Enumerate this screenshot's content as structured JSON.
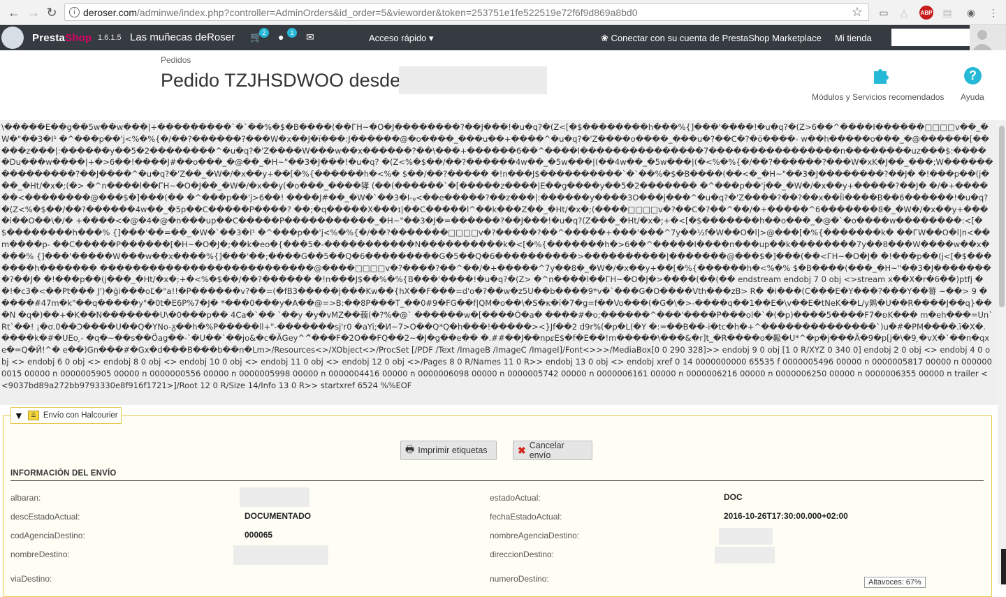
{
  "browser": {
    "url_domain": "deroser.com",
    "url_path": "/adminwe/index.php?controller=AdminOrders&id_order=5&vieworder&token=253751e1fe522519e72f6f9d869a8bd0",
    "abp_label": "ABP"
  },
  "header": {
    "logo_presta": "Presta",
    "logo_shop": "Shop",
    "version": "1.6.1.5",
    "shop_name": "Las muñecas deRoser",
    "orders_badge": "2",
    "customers_badge": "1",
    "quick_access": "Acceso rápido",
    "marketplace": "Conectar con su cuenta de PrestaShop Marketplace",
    "my_store": "Mi tienda"
  },
  "page": {
    "breadcrumb": "Pedidos",
    "title": "Pedido TZJHSDWOO desde",
    "modules_label": "Módulos y Servicios recomendados",
    "help_label": "Ayuda"
  },
  "dump": {
    "text": "\\�����E��g��5w��w���|+���������`�`��%�$�B����(��ГH~�O�J��������?��J���!�u�q?�(Z<[�$��������h���%{]���'����!�u�q?�(Z>6��^����I������□□□□v��_�W�\"��3�I¹ �^���p��'j<%�%{�/��?������?���W�x��J�ï���:J������@�o����_���u��+����^�u�q?�'Z����o����_���u�?��C�?�ö����- w��h�����o���_�@������[�����z���|:������y��5�2��������^�u�q?�'Z����W���w��x������?��\\���+������6��^����I���������������7����������������n��������uz���$:�����Du���w����|+�>6��!����J#��o���_�@��_�H~\"��3�J���!�u�q? �(Z<%�$��/��?������4w��_�5w���|(��4w��_�5w���|(�<%�%{�/��?������?���W�xK�J��_���;W���������������?��J����^�u�q?�'Z��_�W�/�x��y+��[�%{������h�<%� $��/��?����� �!n���J$����������`�`��%�$�B����(��<�_�H~\"��3�J��������?��J� �!���p��(j���_�Ht/�x�:̣(�> �^n����l��ГH~�O�J��_�W�/�x��y(�o���_����㹲 (��(������`�[�����z����|E��g����y��5�2������� �^���p��'j��_�W�/�x��y+�����?��J� �/�+������<��������@���$�]���(�� �^���p��'j>6��! ����J#��_�W�`��3�I-ᵩ<��e�����?��z���|:������y����3O���j���^�u�q?�'Z����?��?��x��Ïi����B��6������!�u�q?�(Z<%�$��/��?������4w��_�5p��C�����P����? ��;�q�����X���ɪ|��C�����l^��k���Z��_�Ht/�x�:̣(����□□□□v�?��C�?��^��/�+�����^6�������8�_�W�/�x��y+����i��O��\\�/� +����<�@�4�@�n���up��C�����P�����������_�H~\"��3�J�=������?��J���!�u�q?(Z���_�Ht/�x�:̣+�<[�$�������h��o���_�@�`�o����w��������:<[�$��������h���% {]���'��=��_�W�`��3�I¹ �^���p��'j<%�%{�/��?�������□□□□v�?�����?��^�����+���'���^7y��½f�W��O�l|>@���[�%{�������k� ��ГW��O�l|n<��m����p- ��C�����P������[�H~�O�J�;��k�eo�{���5�-�����������N����������k�<[�%{�������h�>6��^�����I����n���up��k��������7y��8���W����w��x����% {]���'�����W���w��x����%{]���'��;����G��5��Q�6���������G�5��Q�6����������>����������|�������@���$�]���(��<ГH~�O�J� �!���p��(j<[�$�������h������� ��������������������������@����□□□□v�?����?��^��/�+�����^7y��8�_�W�/�x��y+��[�%{������h�<%�% $�B����(���_�H~\"��3�J��������?��J� �!���p��(j���_�Ht/�x�:̣+�<%�$��/��?������ �!n���J$��%�%{B���'����!�u�q?�(Z> �^n����l��ГH~�O�J�>����(��(�� endstream endobj 7 0 obj <>stream x��X�r�6��)ptfj ��!�c3�<��Pt��� J')�ği���oĽ�\"a!!�P������v?��=(�fB3�����j���Kw��{hX��F���=d'o�?��w�z5U��b����9*v�`���G�O����Vth���zB> R� �i���(C���E�Y���?���Y��䔅 ~��> 9 � ����#47m�k\"��q�����y\"�0t�E6P%7�J� *���0���y�A��@=>B:��8P���T_��0#9�FG��f|QM�o��\\�S�κ�ï�7�g=f��Vo���(�G�\\�>-����q��1��E�\\v��E�tNeK��L/y䴗�U��R����J��q}���N �q�)��+�K��N�������U\\�0���p�� 4Ca�`�� `��y �y�vMZ��䕮(�?%�@` ������w�[����Ó�a� ����#�o;������^���'����P���ol�`�(�p)����5����F7�ʚK��� m�eh���=Un`Rt`��! ¡�ơ.0��Ɔ����U��Q�YNo-ᵹ��h�%P�����ll+\"-�������sj'r0 �aYi;�И~7>O��Q*Q�h���!�����><}Jf��2 d9r%(�p�L(�Y �:=��B��-i�tc�h�+^��������������`)u�#�PM����.ï�X�.����k�#�UEo ̧- �q�~��s��Öag��-`�U��`��jo&�c�ÄGey^^̌���F�2O��FQ��2~�J�g��e�� �.##��J��np𝜀E$�f�E��!m�����\\���&�r]t_�R����o�䶋�U*^�p�j���Ä�9�p[j�\\�9 ̧�vX�`��n�qxe�=Q�Й!^� e��)Gn���#�Gx�d���B���b��n�Lm>/Resources<>/XObject<>/ProcSet [/PDF /Text /ImageB /ImageC /ImageI]/Font<>>>/MediaBox[0 0 290 328]>> endobj 9 0 obj [1 0 R/XYZ 0 340 0] endobj 2 0 obj <> endobj 4 0 obj <> endobj 6 0 obj <> endobj 8 0 obj <> endobj 10 0 obj <> endobj 11 0 obj <> endobj 12 0 obj <>/Pages 8 0 R/Names 11 0 R>> endobj 13 0 obj <> endobj xref 0 14 0000000000 65535 f 0000005496 00000 n 0000005817 00000 n 0000000015 00000 n 0000005905 00000 n 0000000556 00000 n 0000005998 00000 n 0000004416 00000 n 0000006098 00000 n 0000005742 00000 n 0000006161 00000 n 0000006216 00000 n 0000006250 00000 n 0000006355 00000 n trailer <<9037bd89a272bb9793330e8f916f1721>]/Root 12 0 R/Size 14/Info 13 0 R>> startxref 6524 %%EOF"
  },
  "panel": {
    "legend": "Envío con Halcourier",
    "print_label": "Imprimir etiquetas",
    "cancel_label": "Cancelar envío",
    "section_title": "INFORMACIÓN DEL ENVÍO",
    "fields": {
      "albaran_label": "albaran:",
      "albaran_value": "",
      "estado_label": "estadoActual:",
      "estado_value": "DOC",
      "desc_label": "descEstadoActual:",
      "desc_value": "DOCUMENTADO",
      "fecha_label": "fechaEstadoActual:",
      "fecha_value": "2016-10-26T17:30:00.000+02:00",
      "cod_label": "codAgenciaDestino:",
      "cod_value": "000065",
      "nombre_agencia_label": "nombreAgenciaDestino:",
      "nombre_agencia_value": "",
      "nombre_destino_label": "nombreDestino:",
      "nombre_destino_value": "",
      "direccion_label": "direccionDestino:",
      "direccion_value": "",
      "via_label": "viaDestino:",
      "numero_label": "numeroDestino:"
    }
  },
  "tooltip": "Altavoces: 67%"
}
